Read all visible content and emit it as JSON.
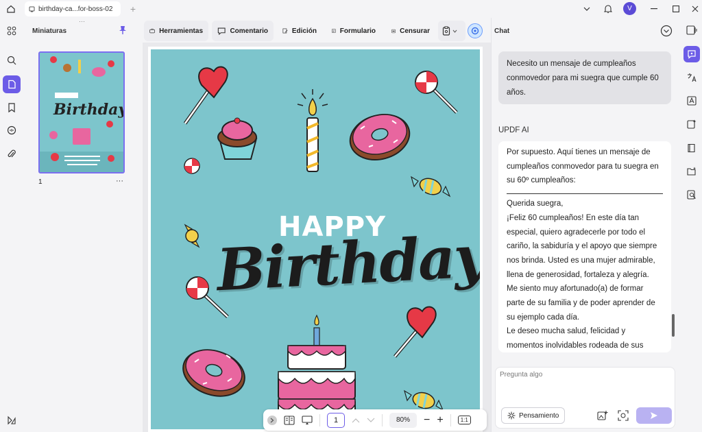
{
  "window": {
    "tab_title": "birthday-ca...for-boss-02",
    "user_initial": "V"
  },
  "thumbnails": {
    "title": "Miniaturas",
    "page_label": "1",
    "more": "···"
  },
  "toolbar": {
    "tools": [
      "Herramientas",
      "Comentario",
      "Edición",
      "Formulario",
      "Censurar"
    ]
  },
  "card": {
    "happy": "HAPPY",
    "birthday": "Birthday"
  },
  "bottom_nav": {
    "page_number": "1",
    "zoom": "80%",
    "fit_label": "1:1"
  },
  "chat": {
    "title": "Chat",
    "user_message": "Necesito un mensaje de cumpleaños conmovedor para mi suegra que cumple 60 años.",
    "ai_name": "UPDF AI",
    "ai_intro": "Por supuesto. Aquí tienes un mensaje de cumpleaños conmovedor para tu suegra en su 60º cumpleaños:",
    "ai_body": [
      "Querida suegra,",
      "¡Feliz 60 cumpleaños! En este día tan especial, quiero agradecerle por todo el cariño, la sabiduría y el apoyo que siempre nos brinda. Usted es una mujer admirable, llena de generosidad, fortaleza y alegría.",
      "Me siento muy afortunado(a) de formar parte de su familia y de poder aprender de su ejemplo cada día.",
      "Le deseo mucha salud, felicidad y momentos inolvidables rodeada de sus"
    ],
    "input_placeholder": "Pregunta algo",
    "thinking_label": "Pensamiento"
  },
  "colors": {
    "accent": "#6c5ce7",
    "card_bg": "#7dc5cc",
    "pink": "#e8669f",
    "red": "#e63946"
  }
}
